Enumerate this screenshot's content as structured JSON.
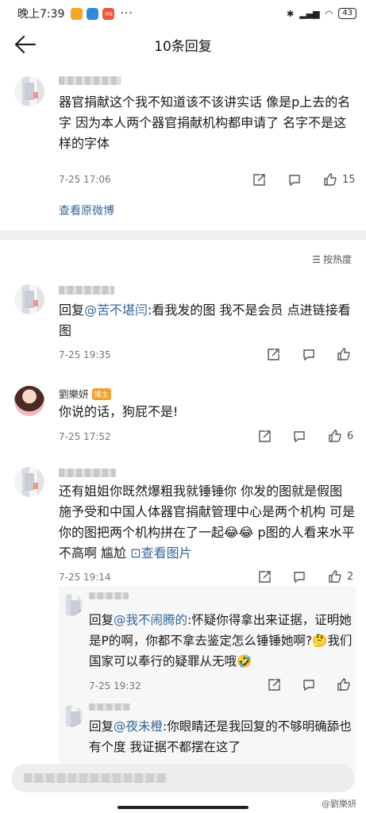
{
  "status": {
    "time": "晚上7:39",
    "battery": "43",
    "more": "···"
  },
  "nav": {
    "title": "10条回复"
  },
  "root": {
    "text": "器官捐献这个我不知道该不该讲实话 像是p上去的名字 因为本人两个器官捐献机构都申请了 名字不是这样的字体",
    "time": "7-25 17:06",
    "likes": "15",
    "view_original": "查看原微博"
  },
  "sort": {
    "label": "按热度"
  },
  "replies": [
    {
      "prefix": "回复",
      "at": "@苦不堪闫",
      "text": ":看我发的图 我不是会员 点进链接看图",
      "time": "7-25 19:35",
      "likes": ""
    },
    {
      "name": "劉樂妍",
      "badge": "博主",
      "text": "你说的话，狗屁不是!",
      "time": "7-25 17:52",
      "likes": "6"
    },
    {
      "text": "还有姐姐你既然爆粗我就锤锤你 你发的图就是假图 施予受和中国人体器官捐献管理中心是两个机构 可是你的图把两个机构拼在了一起😂😂 p图的人看来水平不高啊 尴尬 ",
      "link": "查看图片",
      "time": "7-25 19:14",
      "likes": "2"
    }
  ],
  "sub_replies": [
    {
      "prefix": "回复",
      "at": "@我不闹腾的",
      "text": ":怀疑你得拿出来证据，证明她是P的啊，你都不拿去鉴定怎么锤锤她啊?🤔我们国家可以奉行的疑罪从无哦🤣",
      "time": "7-25 19:32"
    },
    {
      "prefix": "回复",
      "at": "@夜未橙",
      "text": ":你眼睛还是我回复的不够明确舔也有个度 我证据不都摆在这了"
    }
  ],
  "watermark": "@劉樂妍",
  "colors": {
    "link": "#35689b",
    "badge": "#f2a22b",
    "divider": "#f0f0f0"
  }
}
